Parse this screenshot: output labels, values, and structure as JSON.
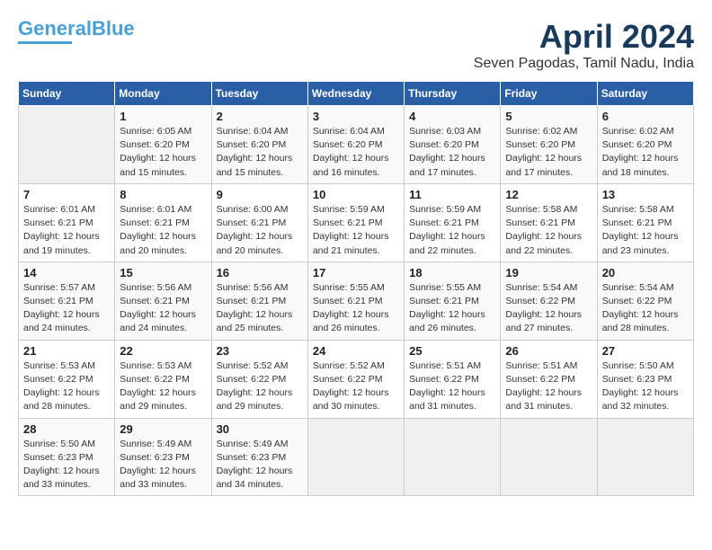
{
  "logo": {
    "line1": "General",
    "line2": "Blue"
  },
  "title": "April 2024",
  "subtitle": "Seven Pagodas, Tamil Nadu, India",
  "headers": [
    "Sunday",
    "Monday",
    "Tuesday",
    "Wednesday",
    "Thursday",
    "Friday",
    "Saturday"
  ],
  "weeks": [
    [
      {
        "day": "",
        "info": ""
      },
      {
        "day": "1",
        "info": "Sunrise: 6:05 AM\nSunset: 6:20 PM\nDaylight: 12 hours\nand 15 minutes."
      },
      {
        "day": "2",
        "info": "Sunrise: 6:04 AM\nSunset: 6:20 PM\nDaylight: 12 hours\nand 15 minutes."
      },
      {
        "day": "3",
        "info": "Sunrise: 6:04 AM\nSunset: 6:20 PM\nDaylight: 12 hours\nand 16 minutes."
      },
      {
        "day": "4",
        "info": "Sunrise: 6:03 AM\nSunset: 6:20 PM\nDaylight: 12 hours\nand 17 minutes."
      },
      {
        "day": "5",
        "info": "Sunrise: 6:02 AM\nSunset: 6:20 PM\nDaylight: 12 hours\nand 17 minutes."
      },
      {
        "day": "6",
        "info": "Sunrise: 6:02 AM\nSunset: 6:20 PM\nDaylight: 12 hours\nand 18 minutes."
      }
    ],
    [
      {
        "day": "7",
        "info": "Sunrise: 6:01 AM\nSunset: 6:21 PM\nDaylight: 12 hours\nand 19 minutes."
      },
      {
        "day": "8",
        "info": "Sunrise: 6:01 AM\nSunset: 6:21 PM\nDaylight: 12 hours\nand 20 minutes."
      },
      {
        "day": "9",
        "info": "Sunrise: 6:00 AM\nSunset: 6:21 PM\nDaylight: 12 hours\nand 20 minutes."
      },
      {
        "day": "10",
        "info": "Sunrise: 5:59 AM\nSunset: 6:21 PM\nDaylight: 12 hours\nand 21 minutes."
      },
      {
        "day": "11",
        "info": "Sunrise: 5:59 AM\nSunset: 6:21 PM\nDaylight: 12 hours\nand 22 minutes."
      },
      {
        "day": "12",
        "info": "Sunrise: 5:58 AM\nSunset: 6:21 PM\nDaylight: 12 hours\nand 22 minutes."
      },
      {
        "day": "13",
        "info": "Sunrise: 5:58 AM\nSunset: 6:21 PM\nDaylight: 12 hours\nand 23 minutes."
      }
    ],
    [
      {
        "day": "14",
        "info": "Sunrise: 5:57 AM\nSunset: 6:21 PM\nDaylight: 12 hours\nand 24 minutes."
      },
      {
        "day": "15",
        "info": "Sunrise: 5:56 AM\nSunset: 6:21 PM\nDaylight: 12 hours\nand 24 minutes."
      },
      {
        "day": "16",
        "info": "Sunrise: 5:56 AM\nSunset: 6:21 PM\nDaylight: 12 hours\nand 25 minutes."
      },
      {
        "day": "17",
        "info": "Sunrise: 5:55 AM\nSunset: 6:21 PM\nDaylight: 12 hours\nand 26 minutes."
      },
      {
        "day": "18",
        "info": "Sunrise: 5:55 AM\nSunset: 6:21 PM\nDaylight: 12 hours\nand 26 minutes."
      },
      {
        "day": "19",
        "info": "Sunrise: 5:54 AM\nSunset: 6:22 PM\nDaylight: 12 hours\nand 27 minutes."
      },
      {
        "day": "20",
        "info": "Sunrise: 5:54 AM\nSunset: 6:22 PM\nDaylight: 12 hours\nand 28 minutes."
      }
    ],
    [
      {
        "day": "21",
        "info": "Sunrise: 5:53 AM\nSunset: 6:22 PM\nDaylight: 12 hours\nand 28 minutes."
      },
      {
        "day": "22",
        "info": "Sunrise: 5:53 AM\nSunset: 6:22 PM\nDaylight: 12 hours\nand 29 minutes."
      },
      {
        "day": "23",
        "info": "Sunrise: 5:52 AM\nSunset: 6:22 PM\nDaylight: 12 hours\nand 29 minutes."
      },
      {
        "day": "24",
        "info": "Sunrise: 5:52 AM\nSunset: 6:22 PM\nDaylight: 12 hours\nand 30 minutes."
      },
      {
        "day": "25",
        "info": "Sunrise: 5:51 AM\nSunset: 6:22 PM\nDaylight: 12 hours\nand 31 minutes."
      },
      {
        "day": "26",
        "info": "Sunrise: 5:51 AM\nSunset: 6:22 PM\nDaylight: 12 hours\nand 31 minutes."
      },
      {
        "day": "27",
        "info": "Sunrise: 5:50 AM\nSunset: 6:23 PM\nDaylight: 12 hours\nand 32 minutes."
      }
    ],
    [
      {
        "day": "28",
        "info": "Sunrise: 5:50 AM\nSunset: 6:23 PM\nDaylight: 12 hours\nand 33 minutes."
      },
      {
        "day": "29",
        "info": "Sunrise: 5:49 AM\nSunset: 6:23 PM\nDaylight: 12 hours\nand 33 minutes."
      },
      {
        "day": "30",
        "info": "Sunrise: 5:49 AM\nSunset: 6:23 PM\nDaylight: 12 hours\nand 34 minutes."
      },
      {
        "day": "",
        "info": ""
      },
      {
        "day": "",
        "info": ""
      },
      {
        "day": "",
        "info": ""
      },
      {
        "day": "",
        "info": ""
      }
    ]
  ]
}
